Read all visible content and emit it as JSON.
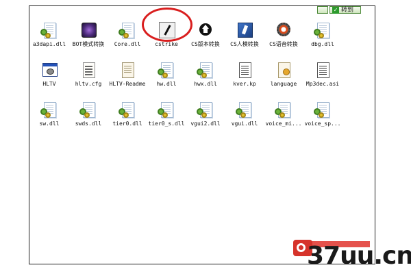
{
  "topbar": {
    "button_label": "转到",
    "check_icon": "check-icon"
  },
  "files_row1": [
    {
      "label": "a3dapi.dll",
      "icon": "dll-icon"
    },
    {
      "label": "BOT模式转换",
      "icon": "app-icon"
    },
    {
      "label": "Core.dll",
      "icon": "dll-icon"
    },
    {
      "label": "cstrike",
      "icon": "counter-strike-icon"
    },
    {
      "label": "CS版本转换",
      "icon": "home-icon"
    },
    {
      "label": "CS人模转换",
      "icon": "app-icon"
    },
    {
      "label": "CS语音转换",
      "icon": "gear-icon"
    },
    {
      "label": "dbg.dll",
      "icon": "dll-icon"
    }
  ],
  "files_row2": [
    {
      "label": "HLTV",
      "icon": "app-window-icon"
    },
    {
      "label": "hltv.cfg",
      "icon": "config-icon"
    },
    {
      "label": "HLTV-Readme",
      "icon": "readme-icon"
    },
    {
      "label": "hw.dll",
      "icon": "dll-icon"
    },
    {
      "label": "hwx.dll",
      "icon": "dll-icon"
    },
    {
      "label": "kver.kp",
      "icon": "kp-file-icon"
    },
    {
      "label": "language",
      "icon": "language-file-icon"
    },
    {
      "label": "Mp3dec.asi",
      "icon": "asi-file-icon"
    }
  ],
  "files_row3": [
    {
      "label": "sw.dll",
      "icon": "dll-icon"
    },
    {
      "label": "swds.dll",
      "icon": "dll-icon"
    },
    {
      "label": "tier0.dll",
      "icon": "dll-icon"
    },
    {
      "label": "tier0_s.dll",
      "icon": "dll-icon"
    },
    {
      "label": "vgui2.dll",
      "icon": "dll-icon"
    },
    {
      "label": "vgui.dll",
      "icon": "dll-icon"
    },
    {
      "label": "voice_mi...",
      "icon": "dll-icon"
    },
    {
      "label": "voice_sp...",
      "icon": "dll-icon"
    }
  ],
  "highlight": {
    "color": "#d91e1e"
  },
  "watermark": {
    "site": "37uu.cn",
    "brand_color": "#d6332b"
  }
}
